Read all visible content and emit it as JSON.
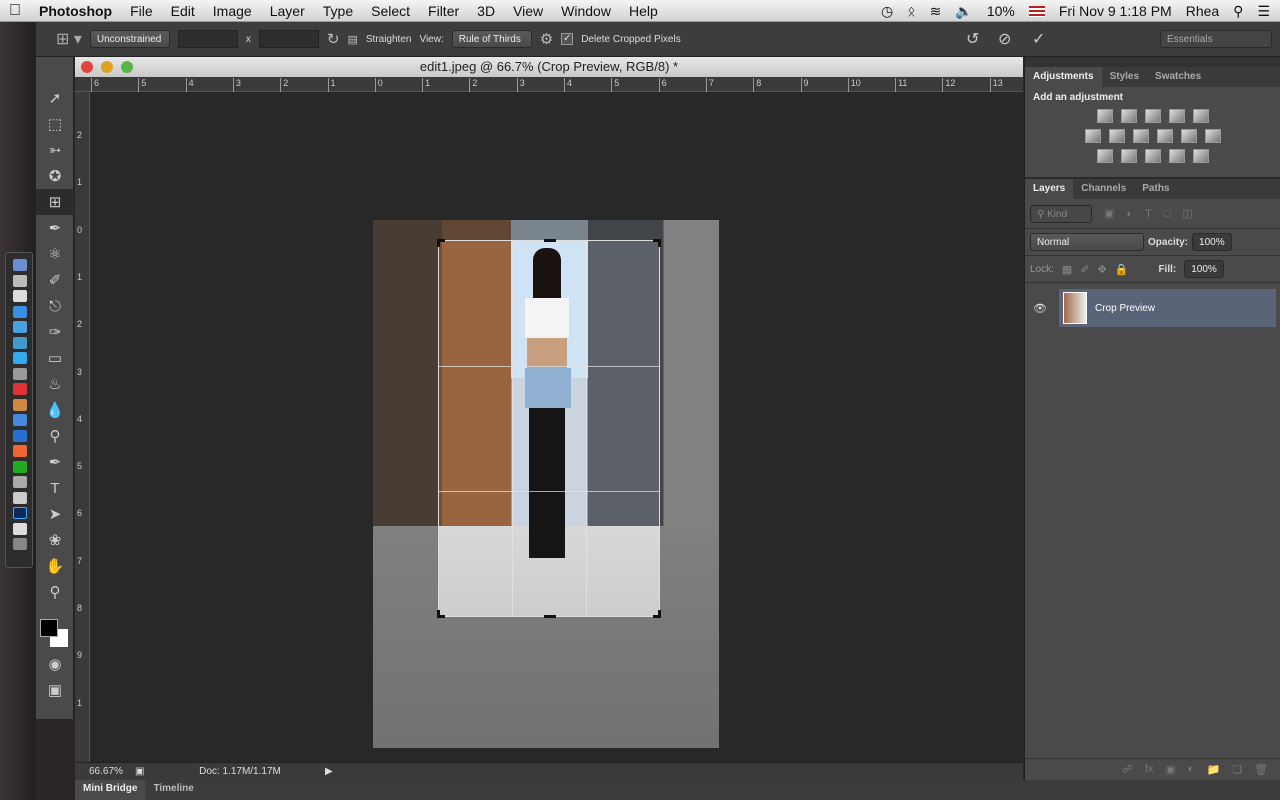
{
  "menubar": {
    "apple": "",
    "app": "Photoshop",
    "items": [
      "File",
      "Edit",
      "Image",
      "Layer",
      "Type",
      "Select",
      "Filter",
      "3D",
      "View",
      "Window",
      "Help"
    ],
    "battery": "10%",
    "datetime": "Fri Nov 9  1:18 PM",
    "user": "Rhea"
  },
  "options": {
    "ratio": "Unconstrained",
    "width": "",
    "height": "",
    "x_sep": "x",
    "straighten": "Straighten",
    "view_label": "View:",
    "view": "Rule of Thirds",
    "delete_cropped": "Delete Cropped Pixels",
    "delete_cropped_checked": true,
    "workspace": "Essentials"
  },
  "document": {
    "title": "edit1.jpeg @ 66.7% (Crop Preview, RGB/8) *",
    "ruler_top": [
      "6",
      "5",
      "4",
      "3",
      "2",
      "1",
      "0",
      "1",
      "2",
      "3",
      "4",
      "5",
      "6",
      "7",
      "8",
      "9",
      "10",
      "11",
      "12",
      "13"
    ],
    "ruler_left": [
      "2",
      "1",
      "0",
      "1",
      "2",
      "3",
      "4",
      "5",
      "6",
      "7",
      "8",
      "9",
      "1"
    ],
    "zoom": "66.67%",
    "doc_info": "Doc: 1.17M/1.17M"
  },
  "bottom_tabs": [
    "Mini Bridge",
    "Timeline"
  ],
  "adjustments": {
    "tabs": [
      "Adjustments",
      "Styles",
      "Swatches"
    ],
    "heading": "Add an adjustment"
  },
  "layers": {
    "tabs": [
      "Layers",
      "Channels",
      "Paths"
    ],
    "filter": "Kind",
    "blend": "Normal",
    "opacity_label": "Opacity:",
    "opacity": "100%",
    "lock_label": "Lock:",
    "fill_label": "Fill:",
    "fill": "100%",
    "items": [
      {
        "name": "Crop Preview",
        "visible": true
      }
    ]
  },
  "tools": [
    "move",
    "marquee",
    "lasso",
    "magic-wand",
    "crop",
    "eyedropper",
    "healing",
    "brush",
    "stamp",
    "history-brush",
    "eraser",
    "paint-bucket",
    "blur",
    "dodge",
    "pen",
    "type",
    "path-select",
    "shape",
    "hand",
    "zoom"
  ],
  "colors": {
    "foreground": "#000000",
    "background": "#ffffff",
    "layer_selected": "#5a6478"
  }
}
